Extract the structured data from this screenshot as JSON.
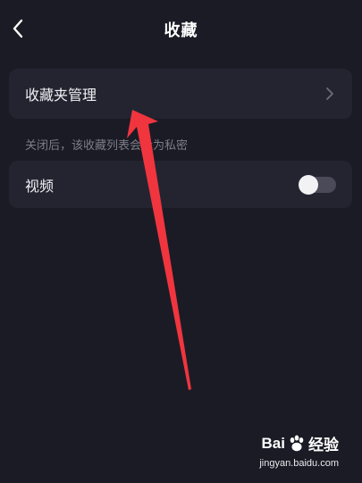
{
  "header": {
    "title": "收藏"
  },
  "folders_card": {
    "label": "收藏夹管理"
  },
  "hint": {
    "text": "关闭后，该收藏列表会设为私密"
  },
  "video_card": {
    "label": "视频",
    "toggle_on": false
  },
  "watermark": {
    "logo_left": "Bai",
    "logo_right": "经验",
    "url": "jingyan.baidu.com"
  },
  "colors": {
    "background": "#1b1b25",
    "card": "#242431",
    "arrow": "#f0353f"
  },
  "icons": {
    "back": "chevron-left-icon",
    "folders_chevron": "chevron-right-icon"
  }
}
